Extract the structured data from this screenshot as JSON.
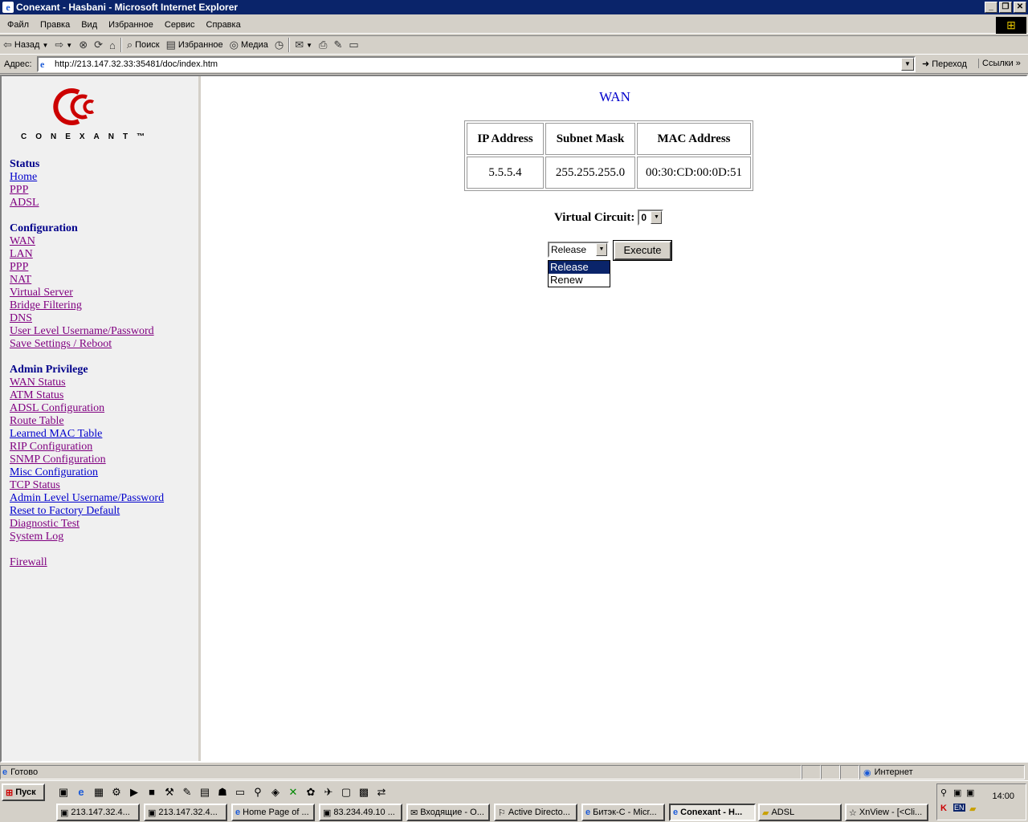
{
  "window": {
    "title": "Conexant - Hasbani - Microsoft Internet Explorer"
  },
  "menu": [
    "Файл",
    "Правка",
    "Вид",
    "Избранное",
    "Сервис",
    "Справка"
  ],
  "toolbar": {
    "back": "Назад",
    "search": "Поиск",
    "favorites": "Избранное",
    "media": "Медиа"
  },
  "address": {
    "label": "Адрес:",
    "url": "http://213.147.32.33:35481/doc/index.htm",
    "go": "Переход",
    "links": "Ссылки"
  },
  "logo": {
    "brand": "CONEXANT™"
  },
  "nav": {
    "status": {
      "heading": "Status",
      "items": [
        "Home",
        "PPP",
        "ADSL"
      ]
    },
    "configuration": {
      "heading": "Configuration",
      "items": [
        "WAN",
        "LAN",
        "PPP",
        "NAT",
        "Virtual Server",
        "Bridge Filtering",
        "DNS",
        "User Level Username/Password",
        "Save Settings / Reboot"
      ]
    },
    "admin": {
      "heading": "Admin Privilege",
      "items": [
        "WAN Status",
        "ATM Status",
        "ADSL Configuration",
        "Route Table",
        "Learned MAC Table",
        "RIP Configuration",
        "SNMP Configuration",
        "Misc Configuration",
        "TCP Status",
        "Admin Level Username/Password",
        "Reset to Factory Default",
        "Diagnostic Test",
        "System Log"
      ]
    },
    "firewall": "Firewall"
  },
  "main": {
    "title": "WAN",
    "table": {
      "headers": [
        "IP Address",
        "Subnet Mask",
        "MAC Address"
      ],
      "row": [
        "5.5.5.4",
        "255.255.255.0",
        "00:30:CD:00:0D:51"
      ]
    },
    "virtual_circuit": {
      "label": "Virtual Circuit:",
      "value": "0"
    },
    "action": {
      "selected": "Release",
      "options": [
        "Release",
        "Renew"
      ],
      "execute": "Execute"
    }
  },
  "statusbar": {
    "text": "Готово",
    "zone": "Интернет"
  },
  "taskbar": {
    "start": "Пуск",
    "tasks": [
      "213.147.32.4...",
      "213.147.32.4...",
      "Home Page of ...",
      "83.234.49.10 ...",
      "Входящие - О...",
      "Active Directo...",
      "Битэк-С - Micr...",
      "Conexant - H...",
      "ADSL",
      "XnView - [<Cli..."
    ],
    "lang": "EN",
    "clock": "14:00"
  }
}
